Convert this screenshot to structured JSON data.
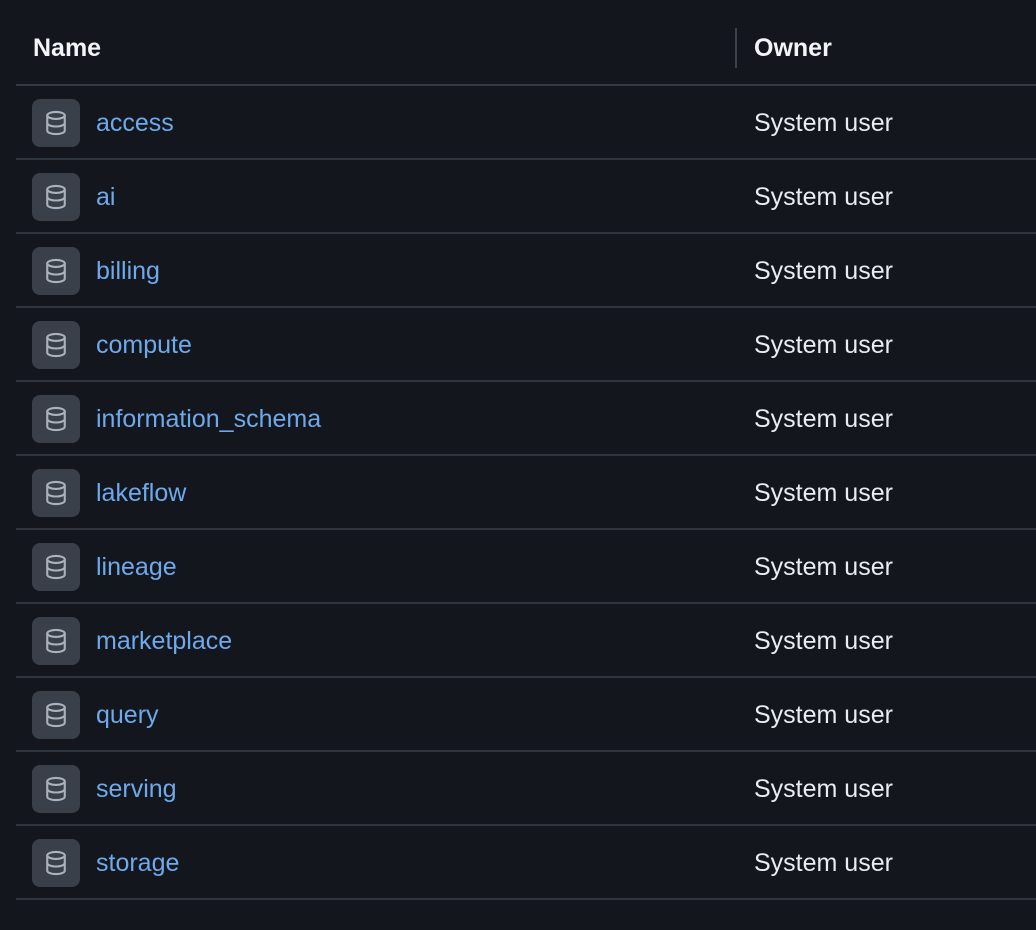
{
  "table": {
    "columns": {
      "name": "Name",
      "owner": "Owner"
    },
    "row_icon": "database-icon",
    "rows": [
      {
        "name": "access",
        "owner": "System user"
      },
      {
        "name": "ai",
        "owner": "System user"
      },
      {
        "name": "billing",
        "owner": "System user"
      },
      {
        "name": "compute",
        "owner": "System user"
      },
      {
        "name": "information_schema",
        "owner": "System user"
      },
      {
        "name": "lakeflow",
        "owner": "System user"
      },
      {
        "name": "lineage",
        "owner": "System user"
      },
      {
        "name": "marketplace",
        "owner": "System user"
      },
      {
        "name": "query",
        "owner": "System user"
      },
      {
        "name": "serving",
        "owner": "System user"
      },
      {
        "name": "storage",
        "owner": "System user"
      }
    ]
  },
  "colors": {
    "background": "#13171d",
    "link": "#6fa9eb",
    "icon_bg": "#3a4049"
  }
}
